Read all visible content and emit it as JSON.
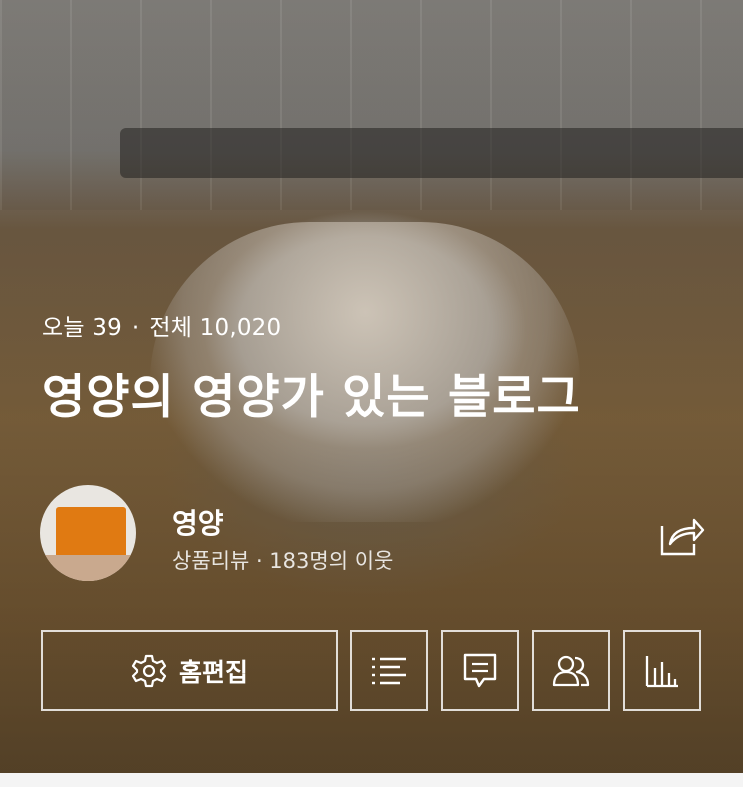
{
  "stats": {
    "today_label": "오늘 39",
    "separator": "·",
    "total_label": "전체 10,020"
  },
  "blog": {
    "title": "영양의 영양가 있는 블로그"
  },
  "profile": {
    "nickname": "영양",
    "meta": "상품리뷰 · 183명의 이웃"
  },
  "actions": {
    "home_edit_label": "홈편집",
    "share_icon": "share-icon",
    "list_icon": "list-icon",
    "comment_icon": "comment-icon",
    "neighbors_icon": "people-icon",
    "stats_icon": "bar-chart-icon"
  },
  "colors": {
    "text": "#ffffff",
    "border": "#ffffff",
    "avatar_box": "#e07a12"
  }
}
